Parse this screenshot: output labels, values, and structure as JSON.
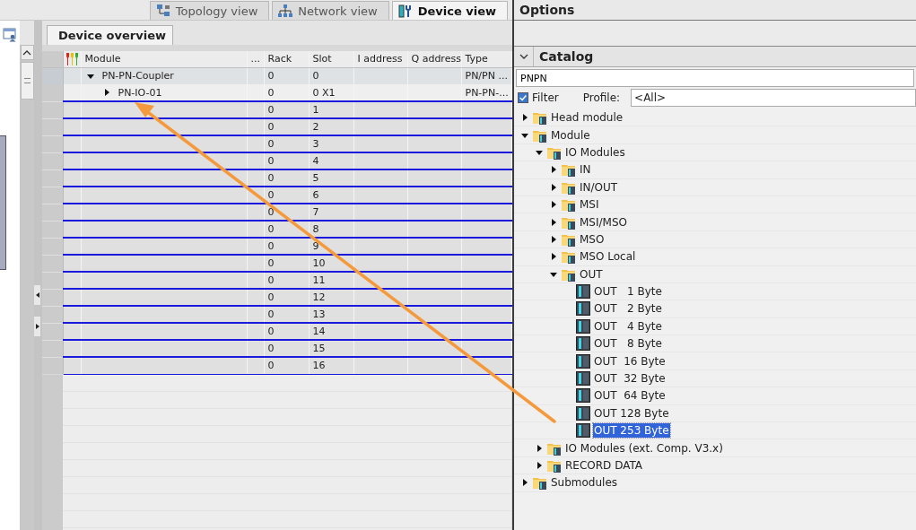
{
  "view_tabs": [
    {
      "label": "Topology view",
      "selected": false
    },
    {
      "label": "Network view",
      "selected": false
    },
    {
      "label": "Device view",
      "selected": true
    }
  ],
  "editor_tab": {
    "label": "Device overview"
  },
  "table": {
    "columns": [
      "Module",
      "...",
      "Rack",
      "Slot",
      "I address",
      "Q address",
      "Type"
    ],
    "rows": [
      {
        "kind": "device",
        "expanded": true,
        "module": "PN-PN-Coupler",
        "rack": "0",
        "slot": "0",
        "type": "PN/PN ..."
      },
      {
        "kind": "submodule",
        "expanded": false,
        "module": "PN-IO-01",
        "rack": "0",
        "slot": "0 X1",
        "type": "PN-PN-..."
      },
      {
        "kind": "slot",
        "rack": "0",
        "slot": "1"
      },
      {
        "kind": "slot",
        "rack": "0",
        "slot": "2"
      },
      {
        "kind": "slot",
        "rack": "0",
        "slot": "3"
      },
      {
        "kind": "slot",
        "rack": "0",
        "slot": "4"
      },
      {
        "kind": "slot",
        "rack": "0",
        "slot": "5"
      },
      {
        "kind": "slot",
        "rack": "0",
        "slot": "6"
      },
      {
        "kind": "slot",
        "rack": "0",
        "slot": "7"
      },
      {
        "kind": "slot",
        "rack": "0",
        "slot": "8"
      },
      {
        "kind": "slot",
        "rack": "0",
        "slot": "9"
      },
      {
        "kind": "slot",
        "rack": "0",
        "slot": "10"
      },
      {
        "kind": "slot",
        "rack": "0",
        "slot": "11"
      },
      {
        "kind": "slot",
        "rack": "0",
        "slot": "12"
      },
      {
        "kind": "slot",
        "rack": "0",
        "slot": "13"
      },
      {
        "kind": "slot",
        "rack": "0",
        "slot": "14"
      },
      {
        "kind": "slot",
        "rack": "0",
        "slot": "15"
      },
      {
        "kind": "slot",
        "rack": "0",
        "slot": "16"
      }
    ]
  },
  "options": {
    "title": "Options"
  },
  "catalog": {
    "title": "Catalog",
    "expanded": true,
    "search": {
      "value": "PNPN"
    },
    "filter": {
      "label": "Filter",
      "checked": true
    },
    "profile": {
      "label": "Profile:",
      "value": "<All>"
    },
    "tree": [
      {
        "kind": "folder",
        "label": "Head module",
        "expanded": false,
        "selected": false
      },
      {
        "kind": "folder",
        "label": "Module",
        "expanded": true,
        "selected": false,
        "children": [
          {
            "kind": "folder",
            "label": "IO Modules",
            "expanded": true,
            "selected": false,
            "children": [
              {
                "kind": "folder",
                "label": "IN",
                "expanded": false,
                "selected": false
              },
              {
                "kind": "folder",
                "label": "IN/OUT",
                "expanded": false,
                "selected": false
              },
              {
                "kind": "folder",
                "label": "MSI",
                "expanded": false,
                "selected": false
              },
              {
                "kind": "folder",
                "label": "MSI/MSO",
                "expanded": false,
                "selected": false
              },
              {
                "kind": "folder",
                "label": "MSO",
                "expanded": false,
                "selected": false
              },
              {
                "kind": "folder",
                "label": "MSO Local",
                "expanded": false,
                "selected": false
              },
              {
                "kind": "folder",
                "label": "OUT",
                "expanded": true,
                "selected": false,
                "children": [
                  {
                    "kind": "module",
                    "label": "OUT   1 Byte",
                    "selected": false
                  },
                  {
                    "kind": "module",
                    "label": "OUT   2 Byte",
                    "selected": false
                  },
                  {
                    "kind": "module",
                    "label": "OUT   4 Byte",
                    "selected": false
                  },
                  {
                    "kind": "module",
                    "label": "OUT   8 Byte",
                    "selected": false
                  },
                  {
                    "kind": "module",
                    "label": "OUT  16 Byte",
                    "selected": false
                  },
                  {
                    "kind": "module",
                    "label": "OUT  32 Byte",
                    "selected": false
                  },
                  {
                    "kind": "module",
                    "label": "OUT  64 Byte",
                    "selected": false
                  },
                  {
                    "kind": "module",
                    "label": "OUT 128 Byte",
                    "selected": false
                  },
                  {
                    "kind": "module",
                    "label": "OUT 253 Byte",
                    "selected": true
                  }
                ]
              }
            ]
          },
          {
            "kind": "folder",
            "label": "IO Modules (ext. Comp. V3.x)",
            "expanded": false,
            "selected": false
          },
          {
            "kind": "folder",
            "label": "RECORD DATA",
            "expanded": false,
            "selected": false
          }
        ]
      },
      {
        "kind": "folder",
        "label": "Submodules",
        "expanded": false,
        "selected": false
      }
    ]
  }
}
